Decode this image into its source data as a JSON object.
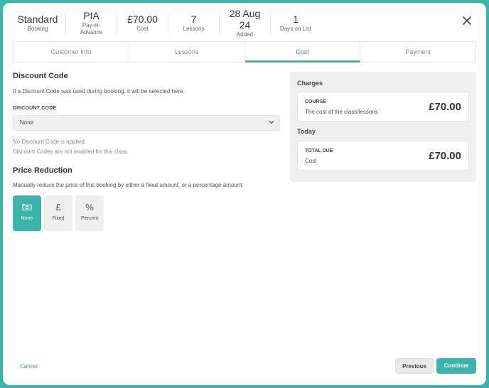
{
  "stats": [
    {
      "value": "Standard",
      "label": "Booking"
    },
    {
      "value": "PIA",
      "label": "Pay-in-Advance"
    },
    {
      "value": "£70.00",
      "label": "Cost"
    },
    {
      "value": "7",
      "label": "Lessons"
    },
    {
      "value": "28 Aug 24",
      "label": "Added"
    },
    {
      "value": "1",
      "label": "Days on List"
    }
  ],
  "tabs": [
    "Customer Info",
    "Lessons",
    "Cost",
    "Payment"
  ],
  "discount": {
    "title": "Discount Code",
    "description": "If a Discount Code was used during booking, it will be selected here.",
    "field_label": "DISCOUNT CODE",
    "selected": "None",
    "note1": "No Discount Code is applied.",
    "note2": "Discount Codes are not enabled for this class."
  },
  "price_reduction": {
    "title": "Price Reduction",
    "description": "Manually reduce the price of this booking by either a fixed amount, or a percentage amount.",
    "options": [
      {
        "label": "None",
        "icon": "cash-icon",
        "glyph": "",
        "active": true
      },
      {
        "label": "Fixed",
        "icon": "pound-icon",
        "glyph": "£",
        "active": false
      },
      {
        "label": "Percent",
        "icon": "percent-icon",
        "glyph": "%",
        "active": false
      }
    ]
  },
  "charges": {
    "heading": "Charges",
    "course_title": "COURSE",
    "course_desc": "The cost of the class/lessons",
    "course_value": "£70.00",
    "today_heading": "Today",
    "total_title": "TOTAL DUE",
    "total_desc": "Cost",
    "total_value": "£70.00"
  },
  "footer": {
    "cancel": "Cancel",
    "previous": "Previous",
    "continue": "Continue"
  },
  "colors": {
    "accent": "#3bb4a9",
    "panel": "#efefef"
  }
}
